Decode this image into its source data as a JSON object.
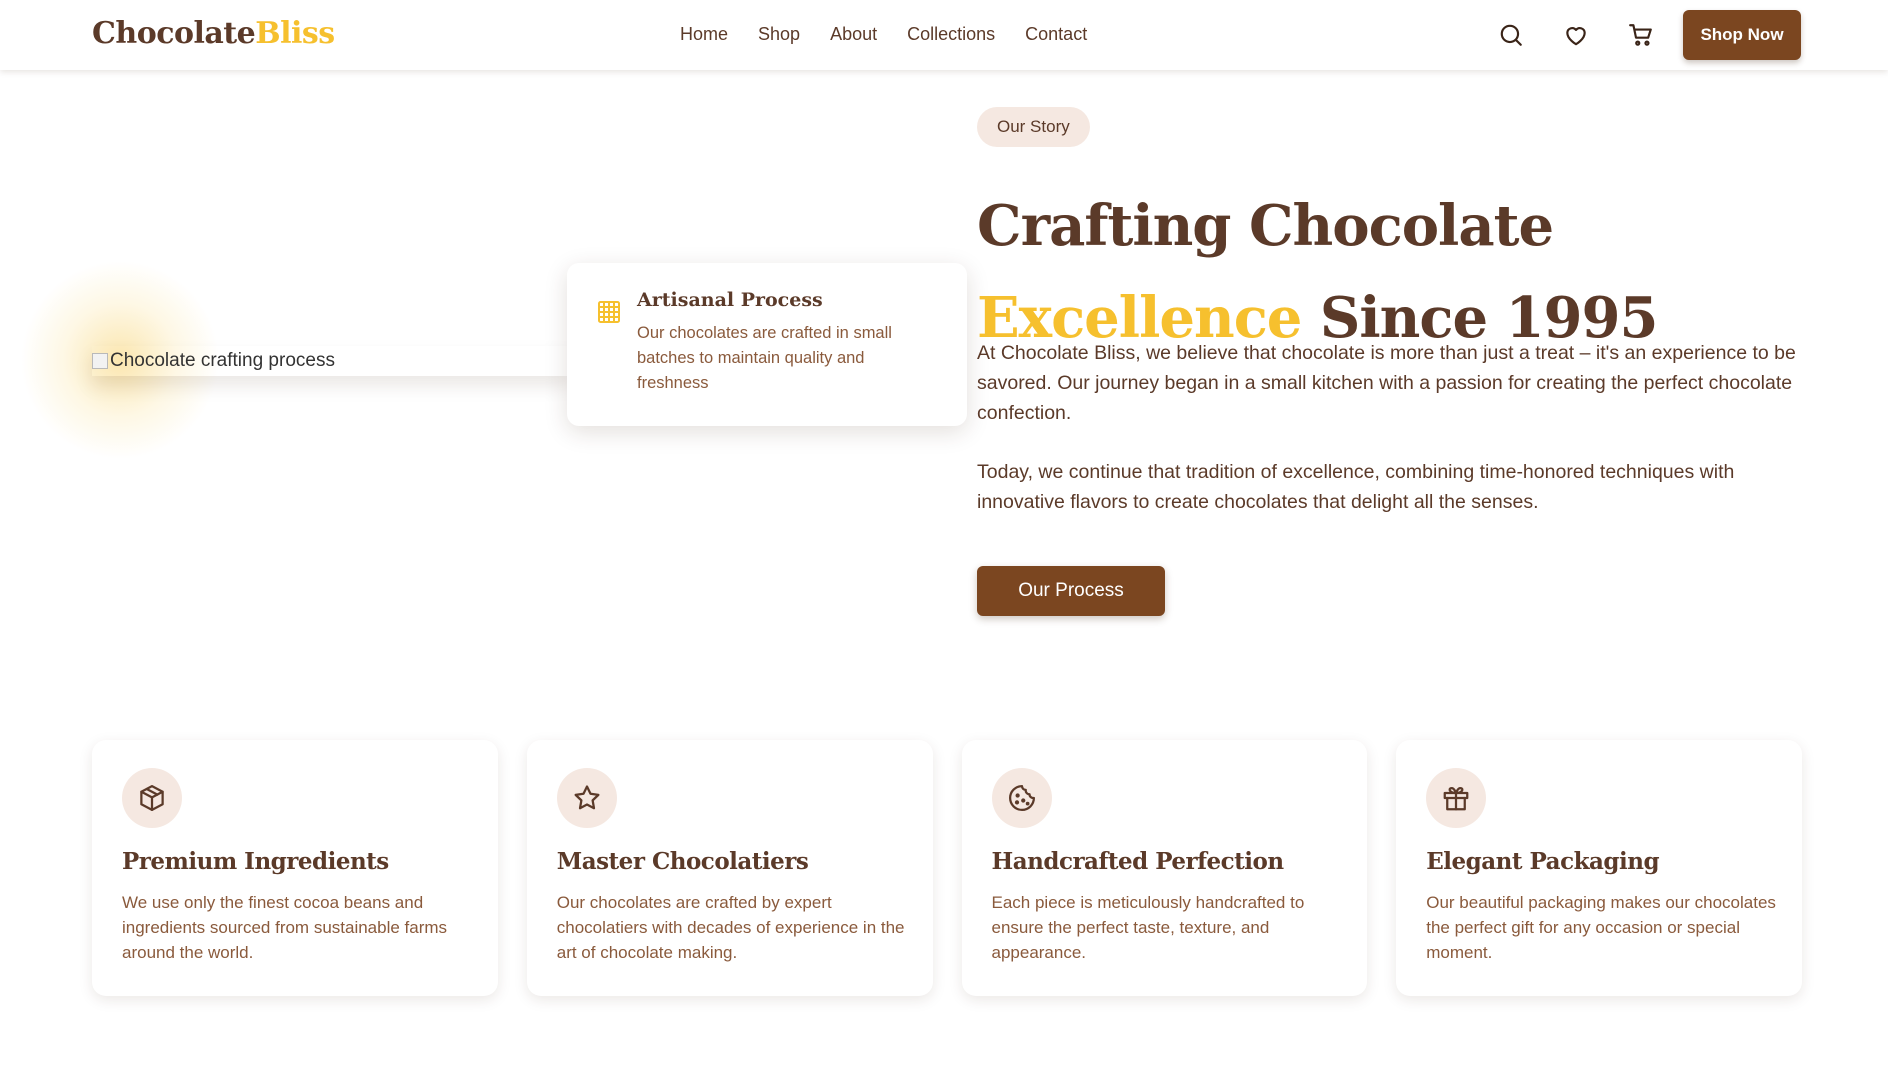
{
  "header": {
    "logo_main": "Chocolate",
    "logo_accent": "Bliss",
    "nav": [
      "Home",
      "Shop",
      "About",
      "Collections",
      "Contact"
    ],
    "icons": [
      "search-icon",
      "heart-icon",
      "cart-icon"
    ],
    "cta_label": "Shop Now"
  },
  "hero": {
    "image_alt": "Chocolate crafting process",
    "process_card": {
      "icon": "grid-icon",
      "title": "Artisanal Process",
      "text": "Our chocolates are crafted in small batches to maintain quality and freshness"
    },
    "badge": "Our Story",
    "title_line1": "Crafting Chocolate",
    "title_accent": "Excellence",
    "title_rest": "Since 1995",
    "paragraph1": "At Chocolate Bliss, we believe that chocolate is more than just a treat – it's an experience to be savored. Our journey began in a small kitchen with a passion for creating the perfect chocolate confection.",
    "paragraph2": "Today, we continue that tradition of excellence, combining time-honored techniques with innovative flavors to create chocolates that delight all the senses.",
    "button_label": "Our Process"
  },
  "features": [
    {
      "icon": "box-icon",
      "title": "Premium Ingredients",
      "text": "We use only the finest cocoa beans and ingredients sourced from sustainable farms around the world."
    },
    {
      "icon": "star-icon",
      "title": "Master Chocolatiers",
      "text": "Our chocolates are crafted by expert chocolatiers with decades of experience in the art of chocolate making."
    },
    {
      "icon": "cookie-icon",
      "title": "Handcrafted Perfection",
      "text": "Each piece is meticulously handcrafted to ensure the perfect taste, texture, and appearance."
    },
    {
      "icon": "gift-icon",
      "title": "Elegant Packaging",
      "text": "Our beautiful packaging makes our chocolates the perfect gift for any occasion or special moment."
    }
  ],
  "colors": {
    "brown": "#5b3a29",
    "button_brown": "#7b4620",
    "gold": "#f6c02e",
    "light_text": "#8a5a3c",
    "badge_bg": "#f5e8e1"
  }
}
